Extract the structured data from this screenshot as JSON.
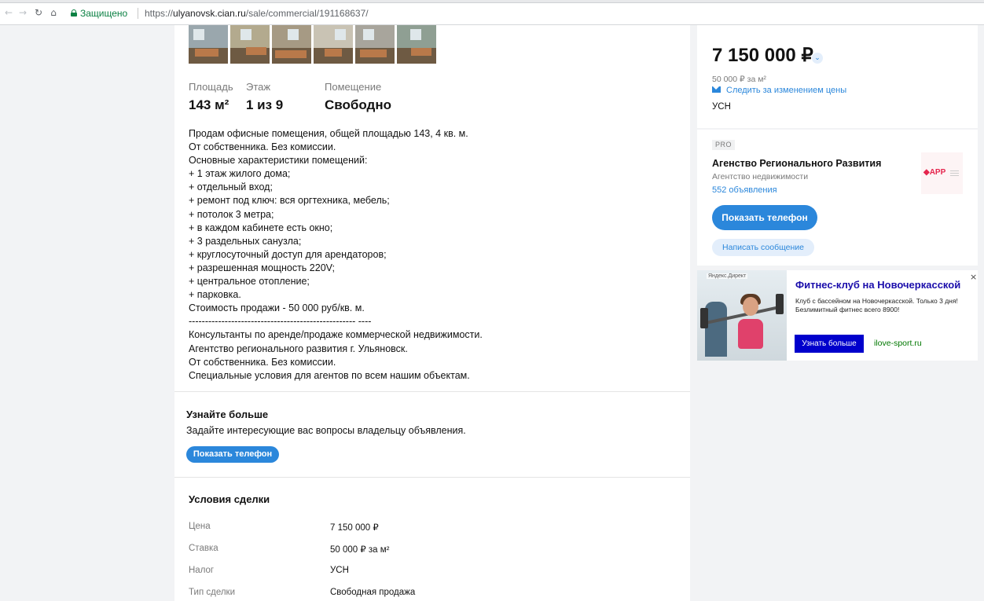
{
  "browser": {
    "secure_label": "Защищено",
    "url_prefix": "https://",
    "url_host": "ulyanovsk.cian.ru",
    "url_path": "/sale/commercial/191168637/"
  },
  "listing": {
    "photos": [
      {
        "name": "photo-1",
        "wall": "#9aa7ad"
      },
      {
        "name": "photo-2",
        "wall": "#b3aa8e"
      },
      {
        "name": "photo-3",
        "wall": "#a69a84"
      },
      {
        "name": "photo-4",
        "wall": "#c9c3b4"
      },
      {
        "name": "photo-5",
        "wall": "#a8a59c"
      },
      {
        "name": "photo-6",
        "wall": "#8f9f93"
      }
    ],
    "facts": [
      {
        "label": "Площадь",
        "value": "143 м²"
      },
      {
        "label": "Этаж",
        "value": "1 из 9"
      },
      {
        "label": "Помещение",
        "value": "Свободно"
      }
    ],
    "description_lines": [
      "Продам офисные помещения, общей площадью 143, 4 кв. м.",
      "От собственника. Без комиссии.",
      "Основные характеристики помещений:",
      "+ 1 этаж жилого дома;",
      "+ отдельный вход;",
      "+ ремонт под ключ: вся оргтехника, мебель;",
      "+ потолок 3 метра;",
      "+ в каждом кабинете есть окно;",
      "+ 3 раздельных санузла;",
      "+ круглосуточный доступ для арендаторов;",
      "+ разрешенная мощность 220V;",
      "+ центральное отопление;",
      "+ парковка.",
      "Стоимость продажи - 50 000 руб/кв. м.",
      "--------------------------------------------------- ----",
      "Консультанты по аренде/продаже коммерческой недвижимости.",
      "Агентство регионального развития г. Ульяновск.",
      "От собственника. Без комиссии.",
      "Специальные условия для агентов по всем нашим объектам."
    ]
  },
  "learn_more": {
    "title": "Узнайте больше",
    "subtitle": "Задайте интересующие вас вопросы владельцу объявления.",
    "button": "Показать телефон"
  },
  "terms": {
    "title": "Условия сделки",
    "rows": [
      {
        "label": "Цена",
        "value": "7 150 000 ₽"
      },
      {
        "label": "Ставка",
        "value": "50 000 ₽ за м²"
      },
      {
        "label": "Налог",
        "value": "УСН"
      },
      {
        "label": "Тип сделки",
        "value": "Свободная продажа"
      }
    ]
  },
  "price": {
    "main": "7 150 000 ₽",
    "per_meter": "50 000 ₽ за м²",
    "follow": "Следить за изменением цены",
    "tax": "УСН"
  },
  "agent": {
    "badge": "PRO",
    "name": "Агенство Регионального Развития",
    "type": "Агентство недвижимости",
    "listings": "552 объявления",
    "logo_text": "APP",
    "show_phone": "Показать телефон",
    "write_message": "Написать сообщение"
  },
  "ad": {
    "label": "Яндекс.Директ",
    "title": "Фитнес-клуб на Новочеркасской",
    "text": "Клуб с бассейном на Новочеркасской. Только 3 дня! Безлимитный фитнес всего 8900!",
    "button": "Узнать больше",
    "domain": "ilove-sport.ru",
    "close": "×"
  },
  "colors": {
    "accent": "#2b87db",
    "secure": "#0b8043",
    "ad_button": "#0000cc",
    "ad_link": "#1a0dab"
  }
}
